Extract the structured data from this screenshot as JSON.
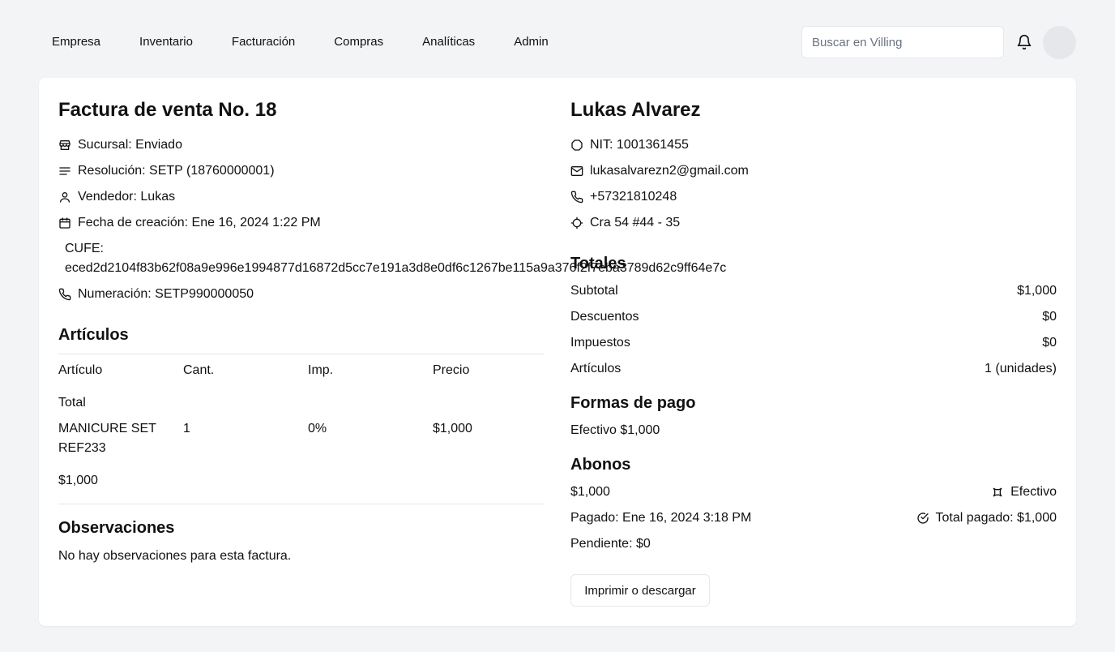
{
  "nav": {
    "items": [
      "Empresa",
      "Inventario",
      "Facturación",
      "Compras",
      "Analíticas",
      "Admin"
    ]
  },
  "search": {
    "placeholder": "Buscar en Villing"
  },
  "invoice": {
    "title": "Factura de venta No. 18",
    "sucursal": "Sucursal: Enviado",
    "resolucion": "Resolución: SETP (18760000001)",
    "vendedor": "Vendedor: Lukas",
    "fecha": "Fecha de creación: Ene 16, 2024 1:22 PM",
    "cufe_label": "CUFE:",
    "cufe_value": "eced2d2104f83b62f08a9e996e1994877d16872d5cc7e191a3d8e0df6c1267be115a9a376f2f7eba3789d62c9ff64e7c",
    "numeracion": "Numeración: SETP990000050"
  },
  "articulos": {
    "heading": "Artículos",
    "columns": [
      "Artículo",
      "Cant.",
      "Imp.",
      "Precio"
    ],
    "total_label": "Total",
    "item": {
      "name_line1": "MANICURE SET",
      "name_line2": "REF233",
      "qty": "1",
      "tax": "0%",
      "price": "$1,000"
    },
    "total_value": "$1,000"
  },
  "observaciones": {
    "heading": "Observaciones",
    "text": "No hay observaciones para esta factura."
  },
  "client": {
    "name": "Lukas Alvarez",
    "nit": "NIT: 1001361455",
    "email": "lukasalvarezn2@gmail.com",
    "phone": "+57321810248",
    "address": "Cra 54 #44 - 35"
  },
  "totales": {
    "heading": "Totales",
    "rows": [
      {
        "label": "Subtotal",
        "value": "$1,000"
      },
      {
        "label": "Descuentos",
        "value": "$0"
      },
      {
        "label": "Impuestos",
        "value": "$0"
      },
      {
        "label": "Artículos",
        "value": "1 (unidades)"
      }
    ]
  },
  "formas_pago": {
    "heading": "Formas de pago",
    "text": "Efectivo $1,000"
  },
  "abonos": {
    "heading": "Abonos",
    "amount": "$1,000",
    "method": "Efectivo",
    "pagado": "Pagado: Ene 16, 2024 3:18 PM",
    "total_pagado": "Total pagado: $1,000",
    "pendiente": "Pendiente: $0"
  },
  "print_button": "Imprimir o descargar"
}
